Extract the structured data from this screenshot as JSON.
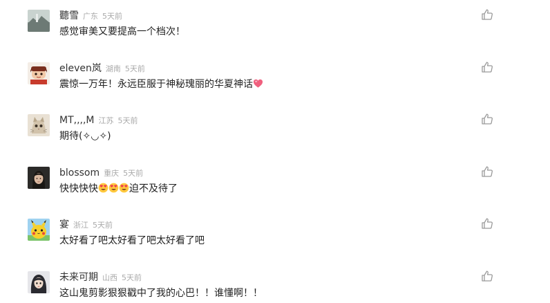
{
  "comments": [
    {
      "username": "聽雪",
      "region": "广东",
      "time": "5天前",
      "text": "感觉审美又要提高一个档次！",
      "avatar_icon": "landscape-photo-avatar"
    },
    {
      "username": "eleven岚",
      "region": "湖南",
      "time": "5天前",
      "text": "震惊一万年！永远臣服于神秘瑰丽的华夏神话",
      "avatar_icon": "cartoon-character-avatar",
      "trailing_emoji": "pink-heart-emoji"
    },
    {
      "username": "MT,,,,M",
      "region": "江苏",
      "time": "5天前",
      "text": "期待(✧◡✧)",
      "avatar_icon": "cat-photo-avatar"
    },
    {
      "username": "blossom",
      "region": "重庆",
      "time": "5天前",
      "text_prefix": "快快快快",
      "text_suffix": "迫不及待了",
      "avatar_icon": "portrait-photo-avatar",
      "emoji": "heart-eyes-emoji"
    },
    {
      "username": "宴",
      "region": "浙江",
      "time": "5天前",
      "text": "太好看了吧太好看了吧太好看了吧",
      "avatar_icon": "pikachu-avatar"
    },
    {
      "username": "未来可期",
      "region": "山西",
      "time": "5天前",
      "text": "这山鬼剪影狠狠戳中了我的心巴！！谁懂啊！！",
      "avatar_icon": "girl-portrait-avatar"
    }
  ],
  "like_icon": "thumbs-up-icon",
  "colors": {
    "username": "#333333",
    "meta": "#aaaaaa",
    "text": "#222222",
    "icon": "#999999"
  }
}
